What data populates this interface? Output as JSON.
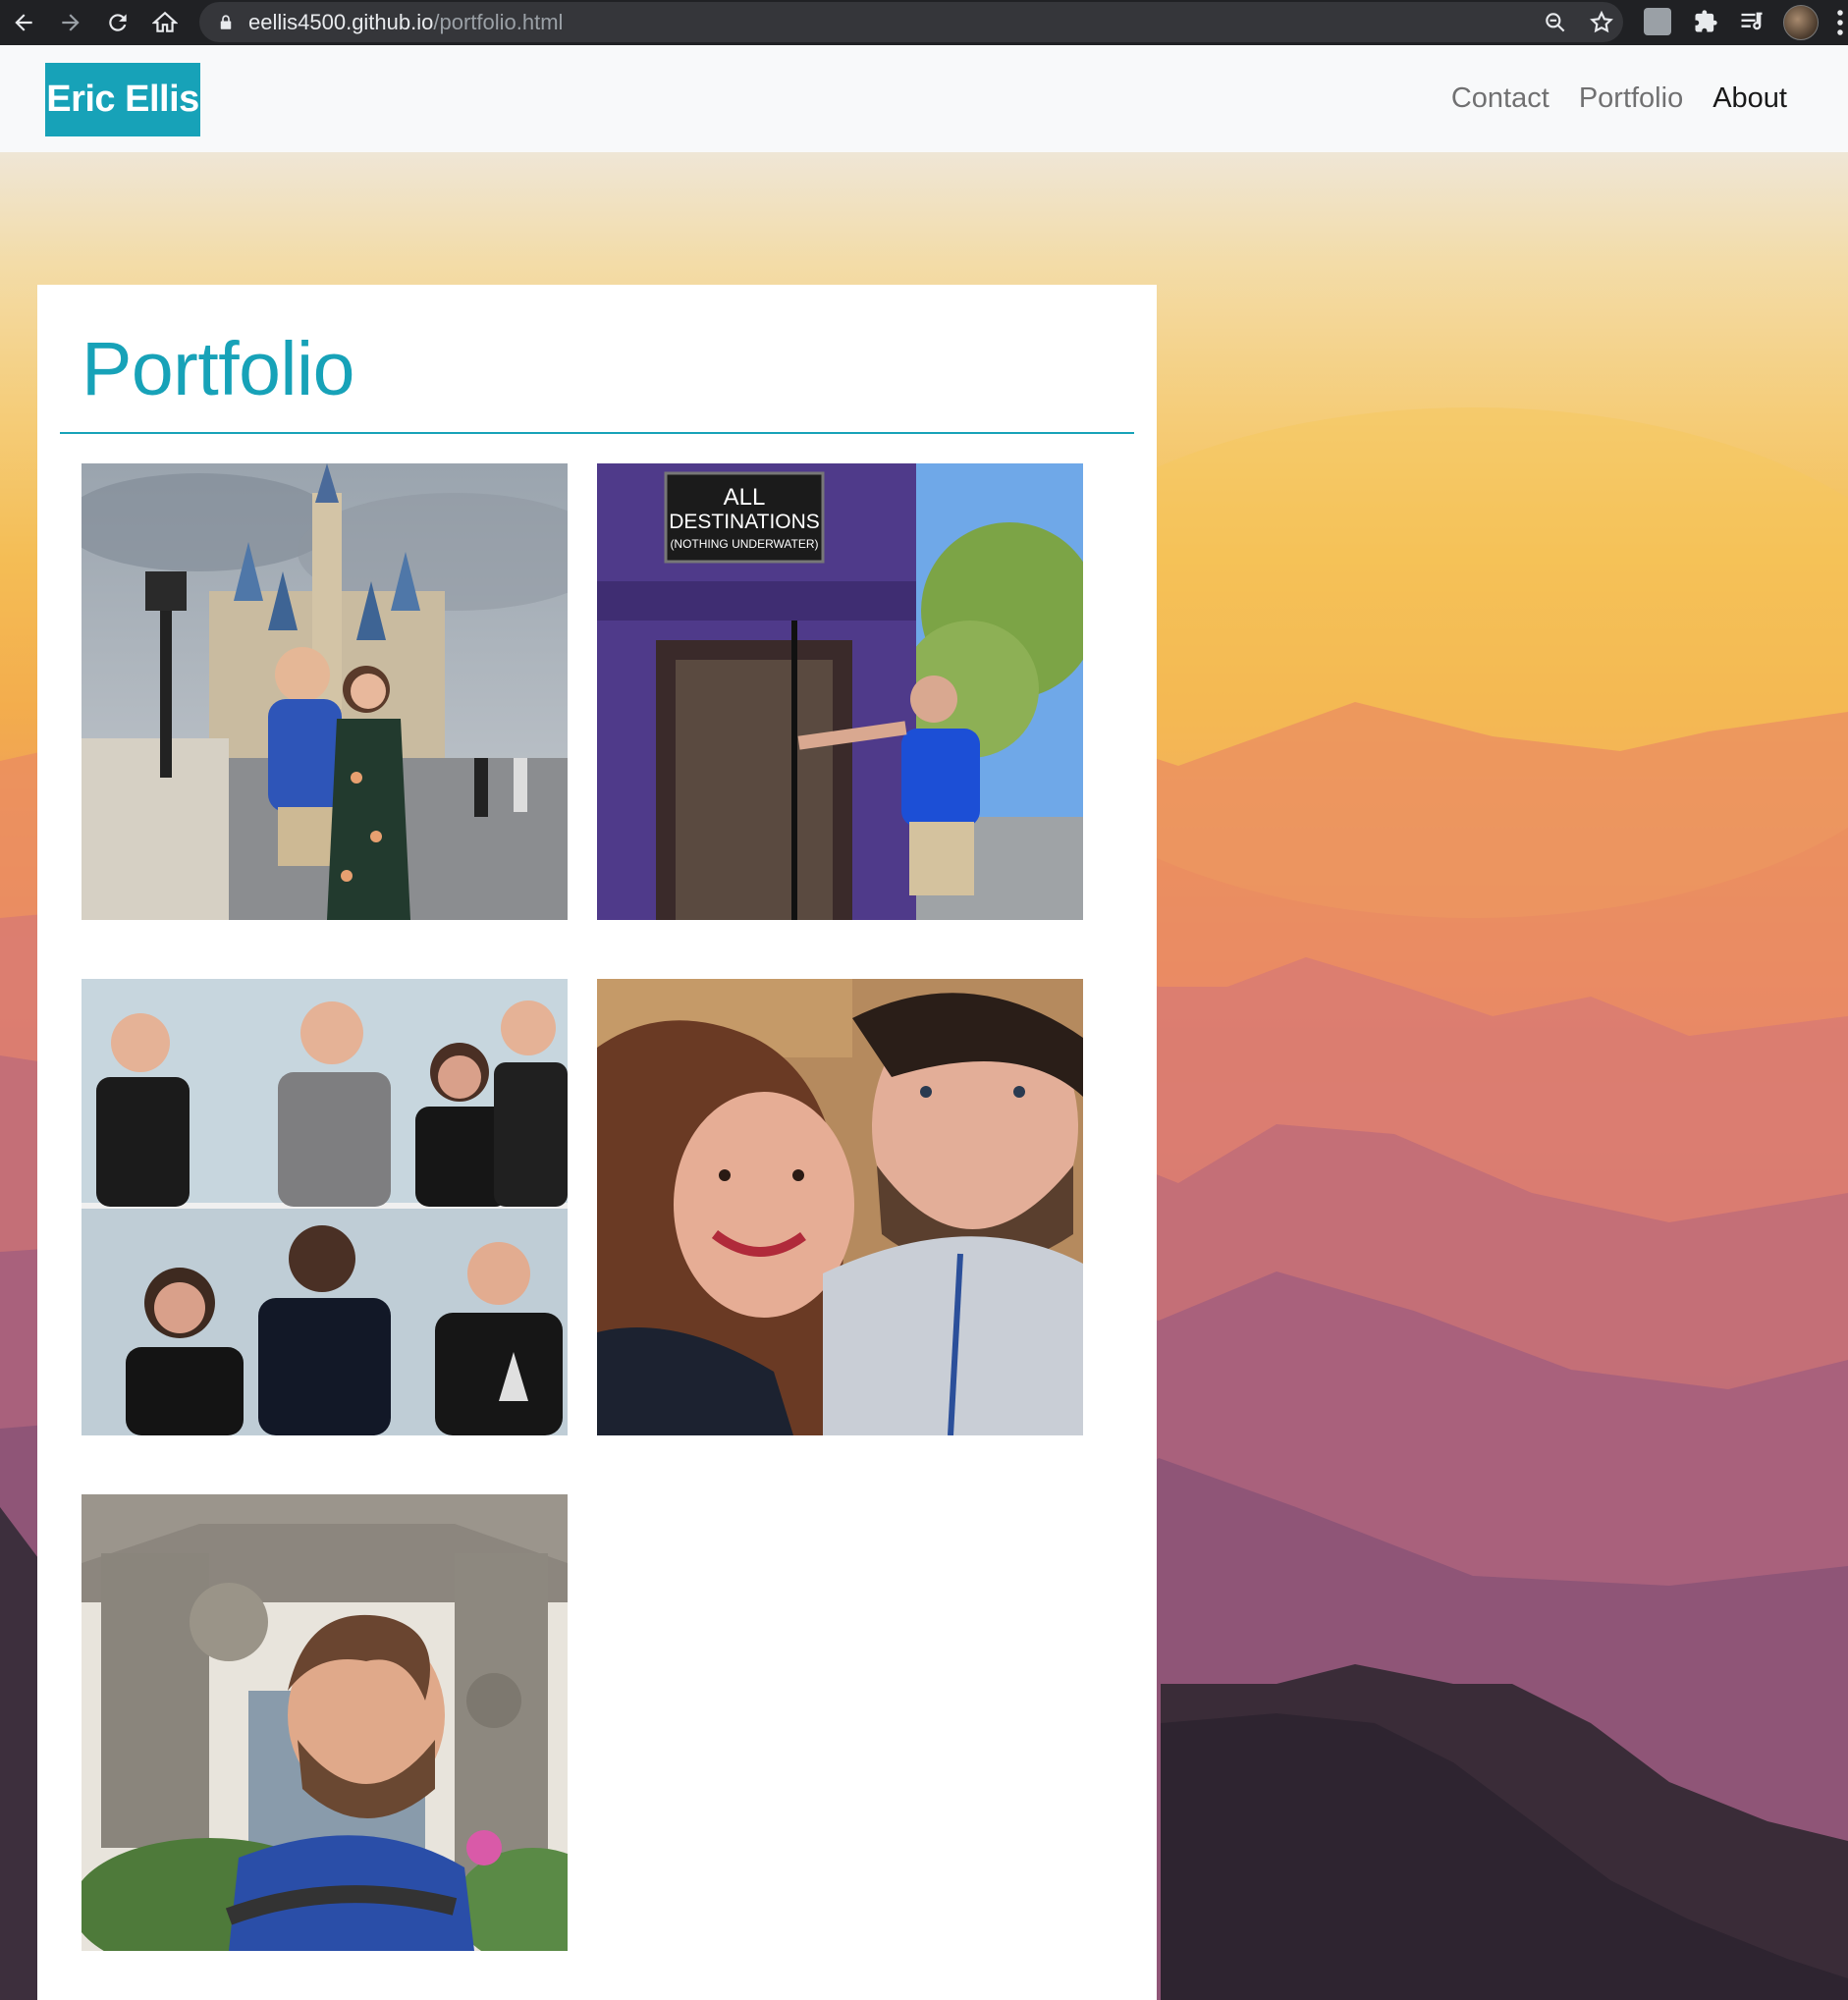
{
  "browser": {
    "url_host": "eellis4500.github.io",
    "url_path": "/portfolio.html",
    "icons": [
      "back-icon",
      "forward-icon",
      "reload-icon",
      "home-icon",
      "lock-icon",
      "zoom-icon",
      "star-icon",
      "extension-icon",
      "puzzle-icon",
      "media-icon",
      "profile-avatar",
      "menu-icon"
    ]
  },
  "nav": {
    "brand": "Eric Ellis",
    "links": [
      {
        "label": "Contact"
      },
      {
        "label": "Portfolio"
      },
      {
        "label": "About"
      }
    ],
    "active_link": "About"
  },
  "main": {
    "title": "Portfolio",
    "photos": [
      {
        "name": "castle-photo"
      },
      {
        "name": "knight-bus-photo"
      },
      {
        "name": "convention-photo"
      },
      {
        "name": "selfie-photo"
      },
      {
        "name": "at-at-photo"
      }
    ],
    "bus_sign": {
      "line1": "ALL",
      "line2": "DESTINATIONS",
      "line3": "(NOTHING UNDERWATER)"
    }
  },
  "colors": {
    "accent": "#17a2b8",
    "navbar_bg": "#f8f9fa",
    "chrome_bg": "#202124"
  }
}
